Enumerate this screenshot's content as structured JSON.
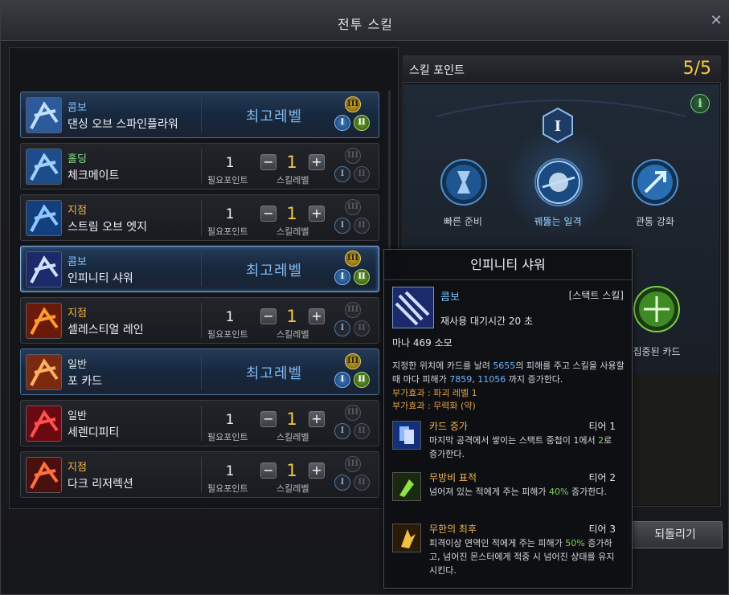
{
  "window": {
    "title": "전투 스킬",
    "close_icon": "close-icon"
  },
  "labels": {
    "need_point": "필요포인트",
    "skill_level": "스킬레벨",
    "max_level": "최고레벨",
    "minus": "−",
    "plus": "+"
  },
  "tiers": {
    "t1": "I",
    "t2": "II",
    "t3": "III"
  },
  "skills": [
    {
      "type": "콤보",
      "type_color": "#7ec3ff",
      "name": "댄싱 오브 스파인플라워",
      "maxed": true,
      "tier_state": [
        "on",
        "on",
        "on"
      ]
    },
    {
      "type": "홀딩",
      "type_color": "#7fe07f",
      "name": "체크메이트",
      "maxed": false,
      "need": "1",
      "level": "1"
    },
    {
      "type": "지점",
      "type_color": "#f5b642",
      "name": "스트림 오브 엣지",
      "maxed": false,
      "need": "1",
      "level": "1"
    },
    {
      "type": "콤보",
      "type_color": "#7ec3ff",
      "name": "인피니티 샤워",
      "maxed": true,
      "selected": true
    },
    {
      "type": "지점",
      "type_color": "#f5b642",
      "name": "셀레스티얼 레인",
      "maxed": false,
      "need": "1",
      "level": "1"
    },
    {
      "type": "일반",
      "type_color": "#e8e8e8",
      "name": "포 카드",
      "maxed": true
    },
    {
      "type": "일반",
      "type_color": "#e8e8e8",
      "name": "세렌디피티",
      "maxed": false,
      "need": "1",
      "level": "1"
    },
    {
      "type": "지점",
      "type_color": "#f5b642",
      "name": "다크 리저렉션",
      "maxed": false,
      "need": "1",
      "level": "1"
    }
  ],
  "skill_point": {
    "title": "스킬 포인트",
    "value": "5/5"
  },
  "tree": {
    "tier_badge": "I",
    "skills": [
      {
        "label": "빠른 준비",
        "selected": false
      },
      {
        "label": "꿰뚫는 일격",
        "selected": true
      },
      {
        "label": "관통 강화",
        "selected": false
      },
      {
        "label": "집중된 카드",
        "selected": false
      }
    ]
  },
  "revert_button": "되돌리기",
  "tooltip": {
    "title": "인피니티 샤워",
    "type": "콤보",
    "stack": "[스택트 스킬]",
    "cooldown": "재사용 대기시간 20 초",
    "mana": "마나 469 소모",
    "desc_parts": [
      "지정한 위치에 카드를 날려 ",
      "5655",
      "의 피해를 주고 스킬을 사용할 때 마다 피해가 ",
      "7859",
      ", ",
      "11056",
      " 까지 증가한다."
    ],
    "extra1": "부가효과 : 파괴 레벨 1",
    "extra2": "부가효과 : 무력화 (약)",
    "tiers": [
      {
        "name": "카드 증가",
        "level": "티어 1",
        "desc_parts": [
          "마지막 공격에서 쌓이는 스택트 중첩이 1에서 ",
          "2",
          "로 증가한다."
        ]
      },
      {
        "name": "무방비 표적",
        "level": "티어 2",
        "desc_parts": [
          "넘어져 있는 적에게 주는 피해가 ",
          "40%",
          " 증가한다."
        ]
      },
      {
        "name": "무한의 최후",
        "level": "티어 3",
        "desc_parts": [
          "피격이상 면역인 적에게 주는 피해가 ",
          "50%",
          " 증가하고, 넘어진 몬스터에게 적중 시 넘어진 상태를 유지 시킨다."
        ]
      }
    ]
  },
  "colors": {
    "gold": "#f5c842",
    "maxed_blue": "#7fb6f0",
    "tier3_gold": "#c8a826",
    "tier1_blue": "#3d7dc8",
    "tier2_green": "#6aa130"
  }
}
